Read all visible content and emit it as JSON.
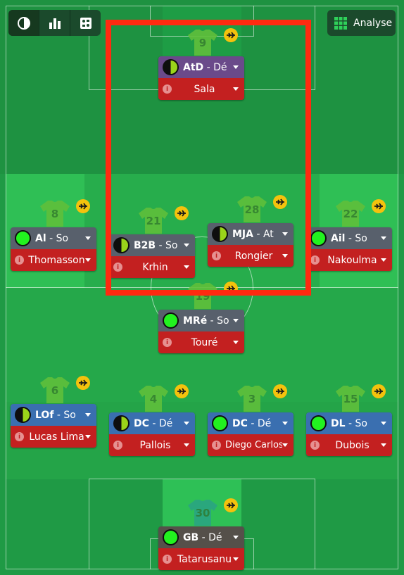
{
  "toolbar": {
    "buttons": [
      {
        "icon": "contrast-icon"
      },
      {
        "icon": "bar-chart-icon"
      },
      {
        "icon": "tactics-icon"
      }
    ],
    "analyse_label": "Analyse"
  },
  "colors": {
    "pitch": "#1f9a45",
    "highlight": "#ff2a10",
    "role_attack": "#6a4a8a",
    "role_support": "#58606c",
    "role_defend": "#3a6fb0",
    "role_gk": "#55504a",
    "name_bar": "#c32020"
  },
  "players": [
    {
      "number": "9",
      "role": "AtD",
      "duty": "Dé",
      "name": "Sala",
      "readiness": "half",
      "color": "#6a4a8a",
      "faded": false
    },
    {
      "number": "8",
      "role": "Al",
      "duty": "So",
      "name": "Thomasson",
      "readiness": "full",
      "color": "#58606c",
      "faded": false
    },
    {
      "number": "21",
      "role": "B2B",
      "duty": "So",
      "name": "Krhin",
      "readiness": "half",
      "color": "#58606c",
      "faded": false
    },
    {
      "number": "28",
      "role": "MJA",
      "duty": "At",
      "name": "Rongier",
      "readiness": "half",
      "color": "#58606c",
      "faded": false
    },
    {
      "number": "22",
      "role": "Ail",
      "duty": "So",
      "name": "Nakoulma",
      "readiness": "full",
      "color": "#58606c",
      "faded": false
    },
    {
      "number": "19",
      "role": "MRé",
      "duty": "So",
      "name": "Touré",
      "readiness": "full",
      "color": "#58606c",
      "faded": false
    },
    {
      "number": "6",
      "role": "LOf",
      "duty": "So",
      "name": "Lucas Lima",
      "readiness": "half",
      "color": "#3a6fb0",
      "faded": false
    },
    {
      "number": "4",
      "role": "DC",
      "duty": "Dé",
      "name": "Pallois",
      "readiness": "half",
      "color": "#3a6fb0",
      "faded": false
    },
    {
      "number": "3",
      "role": "DC",
      "duty": "Dé",
      "name": "Diego Carlos",
      "readiness": "full",
      "color": "#3a6fb0",
      "faded": false
    },
    {
      "number": "15",
      "role": "DL",
      "duty": "So",
      "name": "Dubois",
      "readiness": "full",
      "color": "#3a6fb0",
      "faded": false
    },
    {
      "number": "30",
      "role": "GB",
      "duty": "Dé",
      "name": "Tatarusanu",
      "readiness": "full",
      "color": "#55504a",
      "faded": true
    }
  ]
}
